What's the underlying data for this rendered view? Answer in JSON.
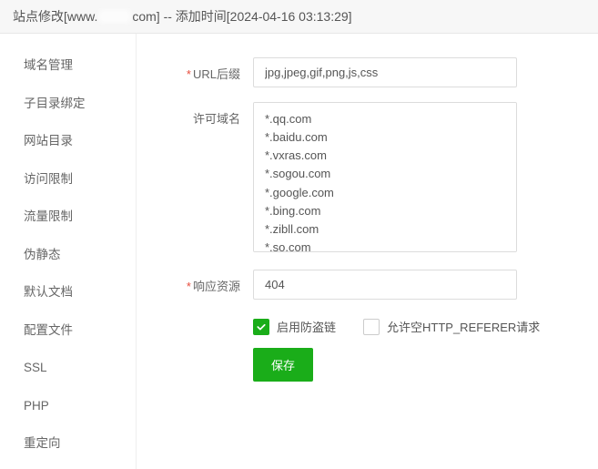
{
  "title": {
    "prefix": "站点修改[www.",
    "suffix": "com] -- 添加时间[2024-04-16 03:13:29]"
  },
  "sidebar": {
    "items": [
      {
        "label": "域名管理"
      },
      {
        "label": "子目录绑定"
      },
      {
        "label": "网站目录"
      },
      {
        "label": "访问限制"
      },
      {
        "label": "流量限制"
      },
      {
        "label": "伪静态"
      },
      {
        "label": "默认文档"
      },
      {
        "label": "配置文件"
      },
      {
        "label": "SSL"
      },
      {
        "label": "PHP"
      },
      {
        "label": "重定向"
      }
    ]
  },
  "form": {
    "url_suffix": {
      "label": "URL后缀",
      "value": "jpg,jpeg,gif,png,js,css"
    },
    "allow_domains": {
      "label": "许可域名",
      "value": "*.qq.com\n*.baidu.com\n*.vxras.com\n*.sogou.com\n*.google.com\n*.bing.com\n*.zibll.com\n*.so.com"
    },
    "response": {
      "label": "响应资源",
      "value": "404"
    },
    "enable_hotlink": {
      "label": "启用防盗链",
      "checked": true
    },
    "allow_empty_referer": {
      "label": "允许空HTTP_REFERER请求",
      "checked": false
    },
    "save_label": "保存"
  }
}
